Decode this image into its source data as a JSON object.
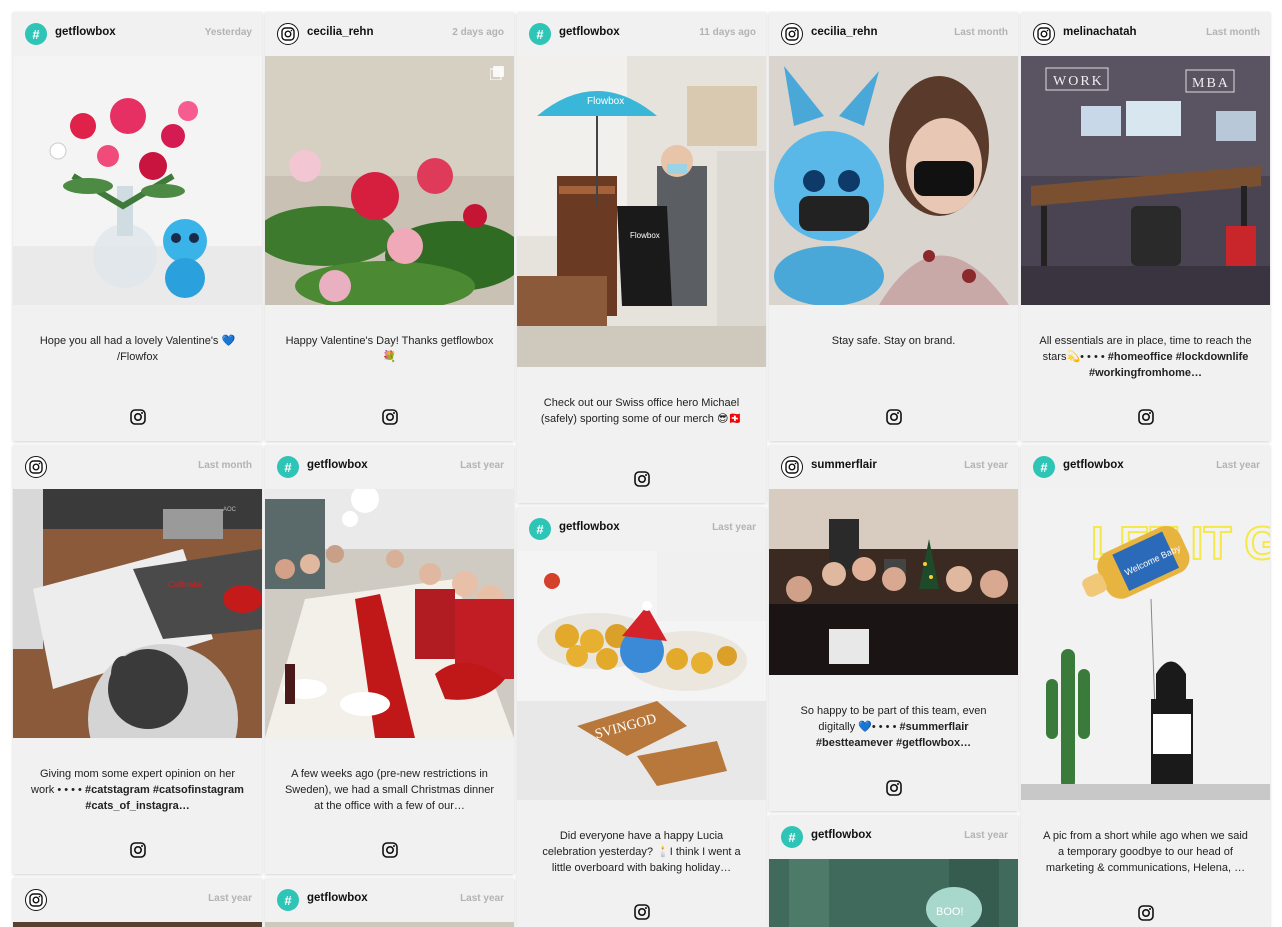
{
  "cards": [
    {
      "username": "getflowbox",
      "time": "Yesterday",
      "caption": "Hope you all had a lovely Valentine's 💙 /Flowfox",
      "tags": ""
    },
    {
      "username": "cecilia_rehn",
      "time": "2 days ago",
      "caption": "Happy Valentine's Day! Thanks getflowbox 💐",
      "tags": ""
    },
    {
      "username": "getflowbox",
      "time": "11 days ago",
      "caption": "Check out our Swiss office hero Michael (safely) sporting some of our merch 😎🇨🇭",
      "tags": ""
    },
    {
      "username": "cecilia_rehn",
      "time": "Last month",
      "caption": "Stay safe. Stay on brand.",
      "tags": ""
    },
    {
      "username": "melinachatah",
      "time": "Last month",
      "caption": "All essentials are in place, time to reach the stars💫• • • • ",
      "tags": "#homeoffice #lockdownlife #workingfromhome…"
    },
    {
      "username": "",
      "time": "Last month",
      "caption": "Giving mom some expert opinion on her work • • • • ",
      "tags": "#catstagram #catsofinstagram #cats_of_instagra…"
    },
    {
      "username": "getflowbox",
      "time": "Last year",
      "caption": "A few weeks ago (pre-new restrictions in Sweden), we had a small Christmas dinner at the office with a few of our…",
      "tags": ""
    },
    {
      "username": "getflowbox",
      "time": "Last year",
      "caption": "Did everyone have a happy Lucia celebration yesterday? 🕯️I think I went a little overboard with baking holiday…",
      "tags": ""
    },
    {
      "username": "summerflair",
      "time": "Last year",
      "caption": "So happy to be part of this team, even digitally 💙• • • • ",
      "tags": "#summerflair #bestteamever #getflowbox…"
    },
    {
      "username": "getflowbox",
      "time": "Last year",
      "caption": "A pic from a short while ago when we said a temporary goodbye to our head of marketing & communications, Helena, …",
      "tags": ""
    },
    {
      "username": "getflowbox",
      "time": "Last year",
      "caption": "",
      "tags": ""
    },
    {
      "username": "",
      "time": "Last year",
      "caption": "",
      "tags": ""
    },
    {
      "username": "getflowbox",
      "time": "Last year",
      "caption": "",
      "tags": ""
    }
  ],
  "photo_text": {
    "umbrella": "Flowbox",
    "shirt": "Flowbox",
    "work": "WORK",
    "mba": "MBA",
    "neon": "LET IT GLOW",
    "bottle": "Welcome Baby",
    "cookies": "SVINGOD",
    "boo": "BOO!",
    "logo": "AOC",
    "mat": "Callbrake"
  },
  "colors": {
    "flowbox_accent": "#2ec4b6",
    "card_bg": "#f1f1f1",
    "time_gray": "#b3b3b3"
  }
}
